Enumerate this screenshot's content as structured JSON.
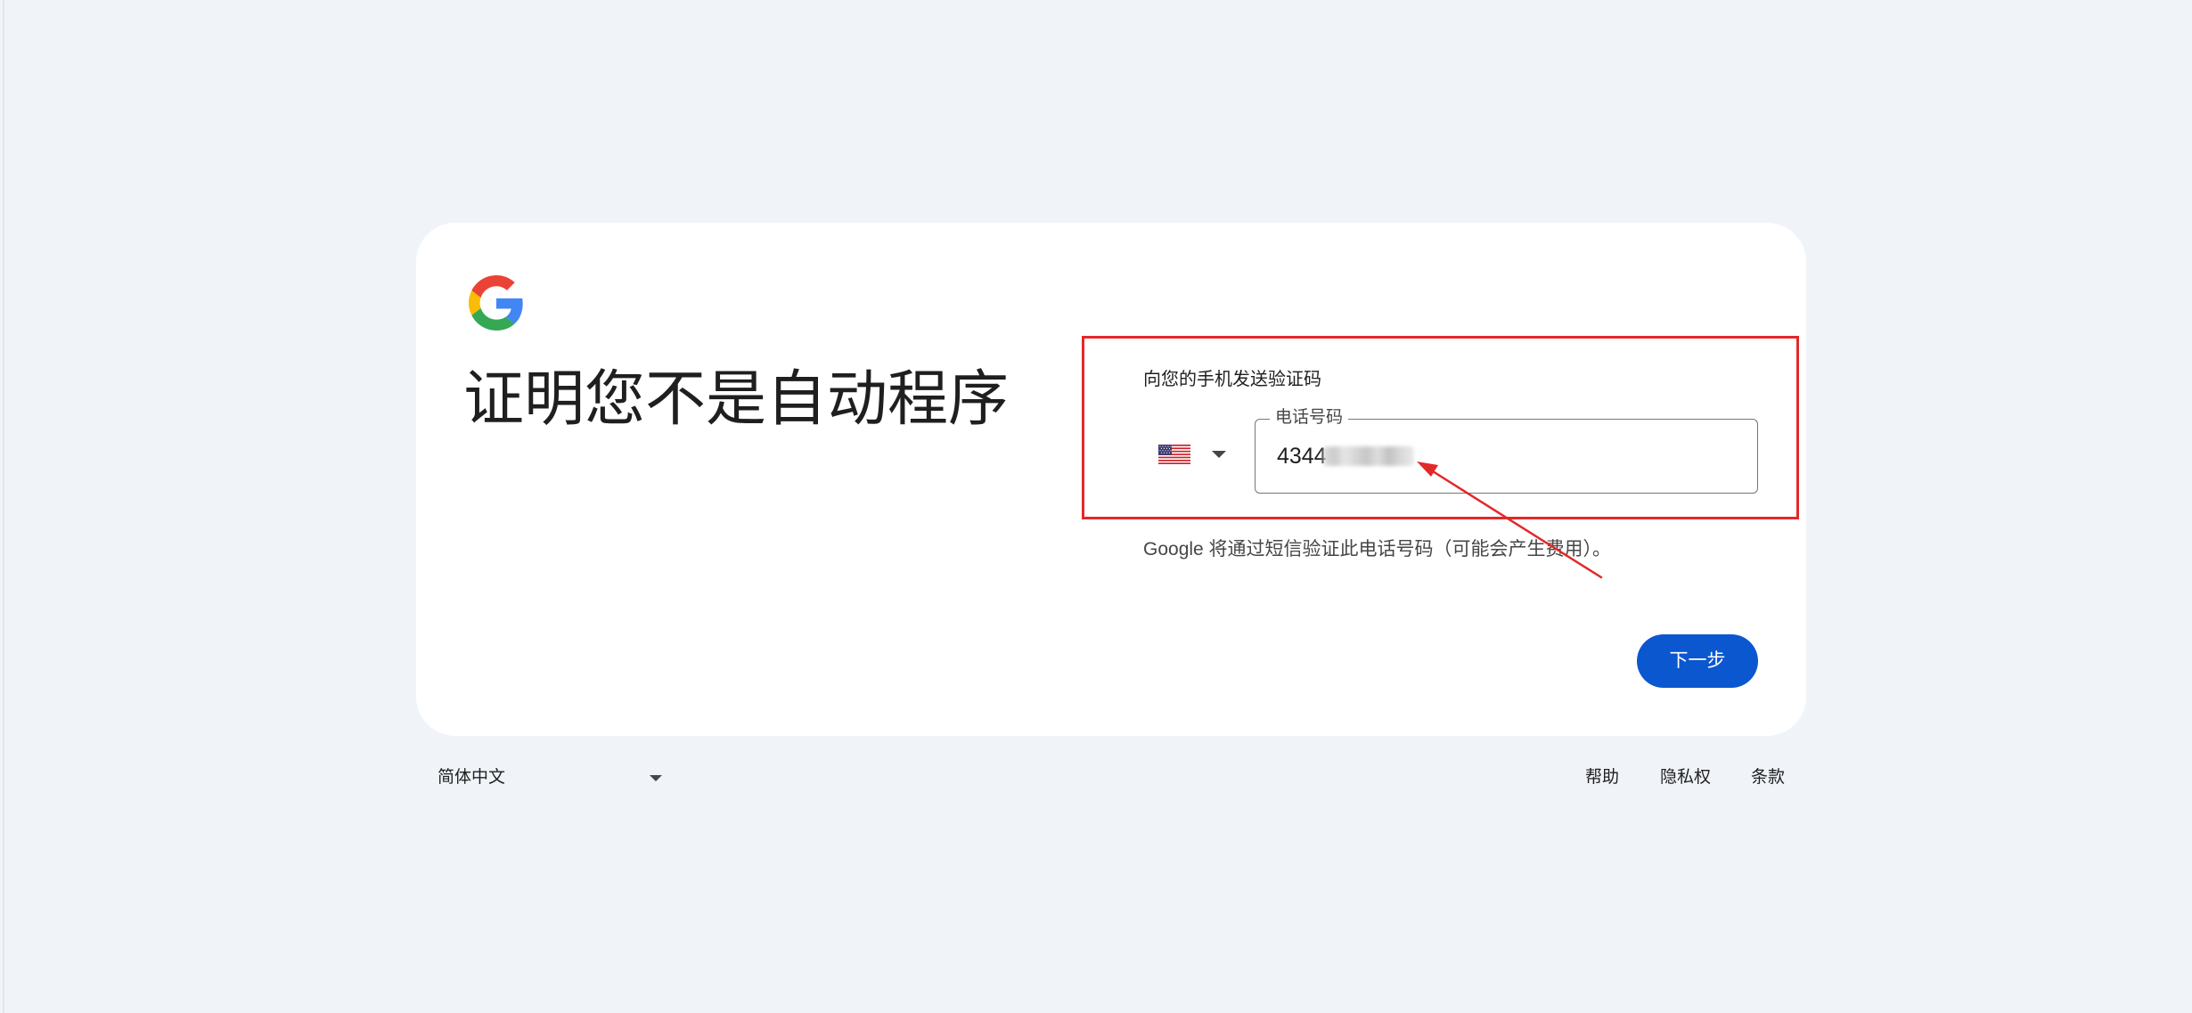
{
  "brand": {
    "logo_icon": "google-g-logo",
    "colors": {
      "blue": "#4285F4",
      "red": "#EA4335",
      "yellow": "#FBBC05",
      "green": "#34A853",
      "primary_button": "#0b57d0",
      "annotation_red": "#e3282a",
      "page_background": "#f0f4f9"
    }
  },
  "page": {
    "title": "证明您不是自动程序"
  },
  "form": {
    "send_label": "向您的手机发送验证码",
    "country": {
      "icon": "us-flag-icon",
      "selected": "United States"
    },
    "phone": {
      "label": "电话号码",
      "value": "4344"
    },
    "sms_note": "Google 将通过短信验证此电话号码（可能会产生费用）。",
    "next_label": "下一步"
  },
  "annotation": {
    "box": "red-highlight-box",
    "arrow": "red-arrow"
  },
  "footer": {
    "language": "简体中文",
    "links": {
      "help": "帮助",
      "privacy": "隐私权",
      "terms": "条款"
    }
  }
}
